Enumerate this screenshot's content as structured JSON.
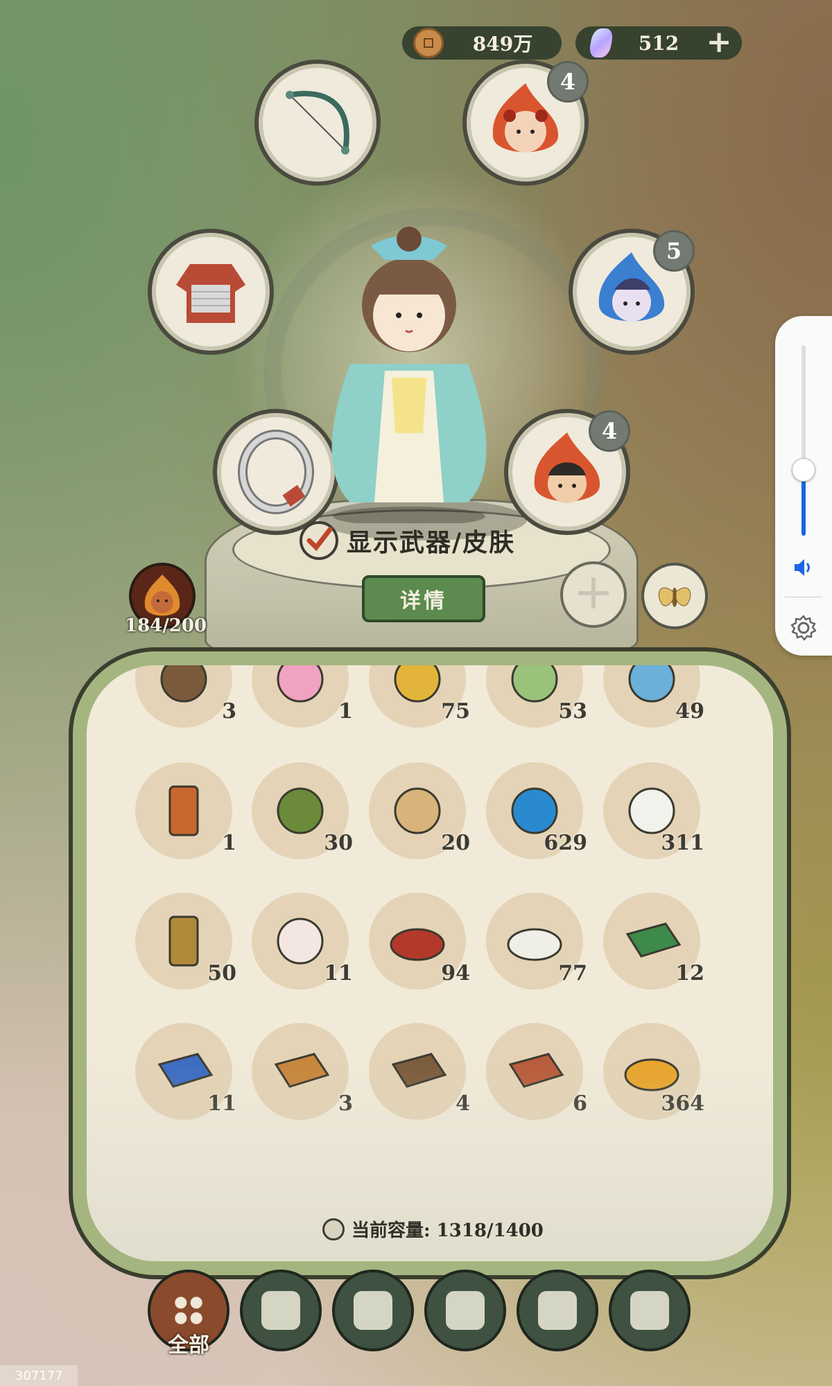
{
  "currency": {
    "coins": "849万",
    "gems": "512"
  },
  "equipment": {
    "weapon_icon": "bow-icon",
    "armor_icon": "armor-icon",
    "ring_icon": "ring-icon"
  },
  "spirits": [
    {
      "name": "fire-spirit-top",
      "level": "4"
    },
    {
      "name": "water-spirit",
      "level": "5"
    },
    {
      "name": "fire-spirit-bottom",
      "level": "4"
    }
  ],
  "toggle_label": "显示武器/皮肤",
  "toggle_checked": true,
  "details_label": "详情",
  "companion": {
    "count": "184/200"
  },
  "inventory": {
    "rows": [
      [
        {
          "icon": "nuts-icon",
          "count": "3"
        },
        {
          "icon": "lotus-icon",
          "count": "1"
        },
        {
          "icon": "grapes-icon",
          "count": "75"
        },
        {
          "icon": "cricket-bag-icon",
          "count": "53"
        },
        {
          "icon": "fish-bag-icon",
          "count": "49"
        }
      ],
      [
        {
          "icon": "token-icon",
          "count": "1"
        },
        {
          "icon": "honeysuckle-icon",
          "count": "30"
        },
        {
          "icon": "planks-icon",
          "count": "20"
        },
        {
          "icon": "water-orb-icon",
          "count": "629"
        },
        {
          "icon": "rice-cake-icon",
          "count": "311"
        }
      ],
      [
        {
          "icon": "plaque-icon",
          "count": "50"
        },
        {
          "icon": "pig-bun-icon",
          "count": "11"
        },
        {
          "icon": "red-powder-icon",
          "count": "94"
        },
        {
          "icon": "white-powder-icon",
          "count": "77"
        },
        {
          "icon": "green-book-icon",
          "count": "12"
        }
      ],
      [
        {
          "icon": "blue-book-icon",
          "count": "11"
        },
        {
          "icon": "fire-book-icon",
          "count": "3"
        },
        {
          "icon": "brown-book-icon",
          "count": "4"
        },
        {
          "icon": "red-book-icon",
          "count": "6"
        },
        {
          "icon": "millet-basket-icon",
          "count": "364"
        }
      ]
    ],
    "capacity_label": "当前容量: 1318/1400"
  },
  "tabs": [
    {
      "name": "tab-all",
      "icon": "grid-icon",
      "label": "全部",
      "active": true
    },
    {
      "name": "tab-wood",
      "icon": "log-icon",
      "label": "",
      "active": false
    },
    {
      "name": "tab-herb",
      "icon": "sprout-icon",
      "label": "",
      "active": false
    },
    {
      "name": "tab-food",
      "icon": "rice-bowl-icon",
      "label": "",
      "active": false
    },
    {
      "name": "tab-ore",
      "icon": "stone-icon",
      "label": "",
      "active": false
    },
    {
      "name": "tab-scroll",
      "icon": "scroll-icon",
      "label": "",
      "active": false
    }
  ],
  "volume": {
    "level": 0.35,
    "icon": "speaker-icon",
    "settings_icon": "gear-icon"
  },
  "corner_label": "307177"
}
